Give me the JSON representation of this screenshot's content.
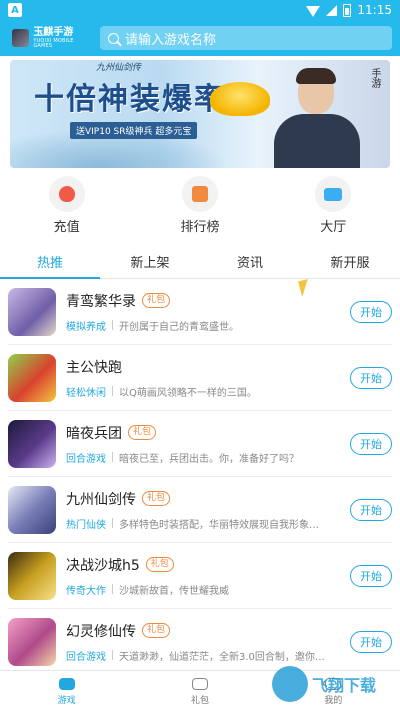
{
  "status_bar": {
    "left_badge": "A",
    "time": "11:15"
  },
  "header": {
    "logo_cn": "玉麒手游",
    "logo_en": "YUQIXI MOBILE GAMES",
    "search_placeholder": "请输入游戏名称"
  },
  "banner": {
    "title": "十倍神装爆率",
    "subtitle": "送VIP10 SR级神兵 超多元宝",
    "top_mark": "九州仙剑传",
    "side_mark": "手游"
  },
  "quick_menu": [
    {
      "label": "充值",
      "icon": "piggy-bank-icon"
    },
    {
      "label": "排行榜",
      "icon": "ranking-icon"
    },
    {
      "label": "大厅",
      "icon": "gamepad-hall-icon"
    }
  ],
  "tabs": [
    {
      "label": "热推",
      "active": true
    },
    {
      "label": "新上架",
      "active": false
    },
    {
      "label": "资讯",
      "active": false
    },
    {
      "label": "新开服",
      "active": false
    }
  ],
  "games": [
    {
      "name": "青鸾繁华录",
      "gift": "礼包",
      "category": "模拟养成",
      "desc": "开创属于自己的青鸾盛世。",
      "button": "开始"
    },
    {
      "name": "主公快跑",
      "gift": "",
      "category": "轻松休闲",
      "desc": "以Q萌画风领略不一样的三国。",
      "button": "开始"
    },
    {
      "name": "暗夜兵团",
      "gift": "礼包",
      "category": "回合游戏",
      "desc": "暗夜已至，兵团出击。你，准备好了吗？",
      "button": "开始"
    },
    {
      "name": "九州仙剑传",
      "gift": "礼包",
      "category": "热门仙侠",
      "desc": "多样特色时装搭配，华丽特效展现自我形象…",
      "button": "开始"
    },
    {
      "name": "决战沙城h5",
      "gift": "礼包",
      "category": "传奇大作",
      "desc": "沙城新故首，传世耀我威",
      "button": "开始"
    },
    {
      "name": "幻灵修仙传",
      "gift": "礼包",
      "category": "回合游戏",
      "desc": "天道渺渺，仙道茫茫，全新3.0回合制，邀你…",
      "button": "开始"
    }
  ],
  "bottom_nav": [
    {
      "label": "游戏",
      "active": true
    },
    {
      "label": "礼包",
      "active": false
    },
    {
      "label": "我的",
      "active": false
    }
  ],
  "watermark": {
    "text": "飞翔下载"
  },
  "colors": {
    "primary": "#26b9ec",
    "accent": "#22a8e0",
    "gift": "#f08a3c"
  }
}
